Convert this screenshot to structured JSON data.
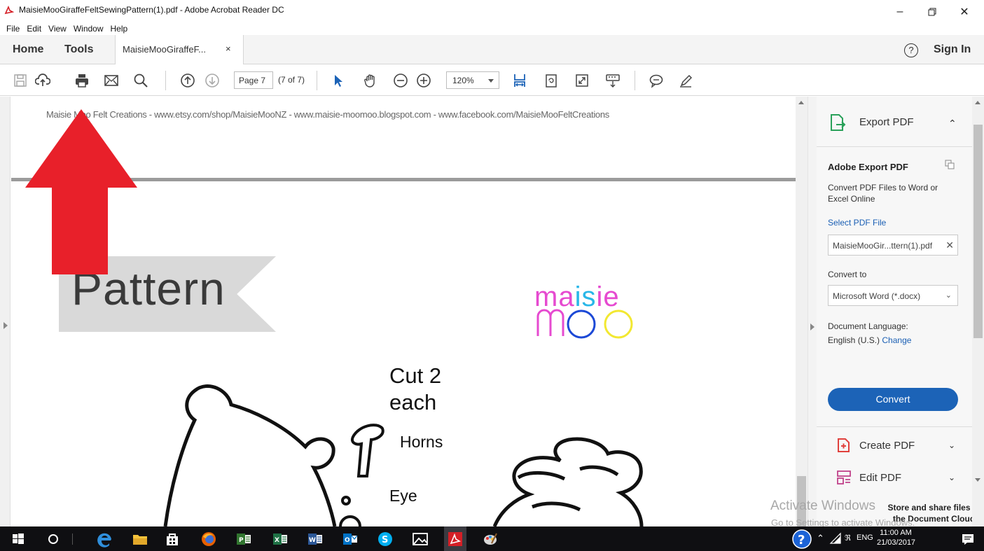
{
  "window": {
    "title": "MaisieMooGiraffeFeltSewingPattern(1).pdf - Adobe Acrobat Reader DC",
    "menu": [
      "File",
      "Edit",
      "View",
      "Window",
      "Help"
    ]
  },
  "tabs": {
    "home": "Home",
    "tools": "Tools",
    "document": "MaisieMooGiraffeF...",
    "close": "×",
    "help": "?",
    "sign_in": "Sign In"
  },
  "toolbar": {
    "page_input": "Page 7",
    "page_count": "(7 of 7)",
    "zoom": "120%"
  },
  "document": {
    "header": "Maisie Moo Felt Creations   -   www.etsy.com/shop/MaisieMooNZ   -   www.maisie-moomoo.blogspot.com   -   www.facebook.com/MaisieMooFeltCreations",
    "pattern_title": "Pattern",
    "logo_line1": "maisie",
    "logo_line2": "moo",
    "cut_line1": "Cut 2",
    "cut_line2": "each",
    "horns": "Horns",
    "eye": "Eye"
  },
  "panel": {
    "export_title": "Export PDF",
    "section_title": "Adobe Export PDF",
    "description": "Convert PDF Files to Word or Excel Online",
    "select_file": "Select PDF File",
    "file_name": "MaisieMooGir...ttern(1).pdf",
    "convert_to_label": "Convert to",
    "convert_to_value": "Microsoft Word (*.docx)",
    "language_label": "Document Language:",
    "language_value": "English (U.S.)",
    "language_change": "Change",
    "convert_button": "Convert",
    "create_pdf": "Create PDF",
    "edit_pdf": "Edit PDF",
    "store_text": "Store and share files in the Document Cloud"
  },
  "watermark": {
    "line1": "Activate Windows",
    "line2": "Go to Settings to activate Windows."
  },
  "taskbar": {
    "language": "ENG",
    "time": "11:00 AM",
    "date": "21/03/2017"
  },
  "colors": {
    "arrow": "#e8202a",
    "accent_blue": "#1c63b7",
    "logo": [
      "#e64ad0",
      "#29b7e8",
      "#f2e832"
    ]
  }
}
